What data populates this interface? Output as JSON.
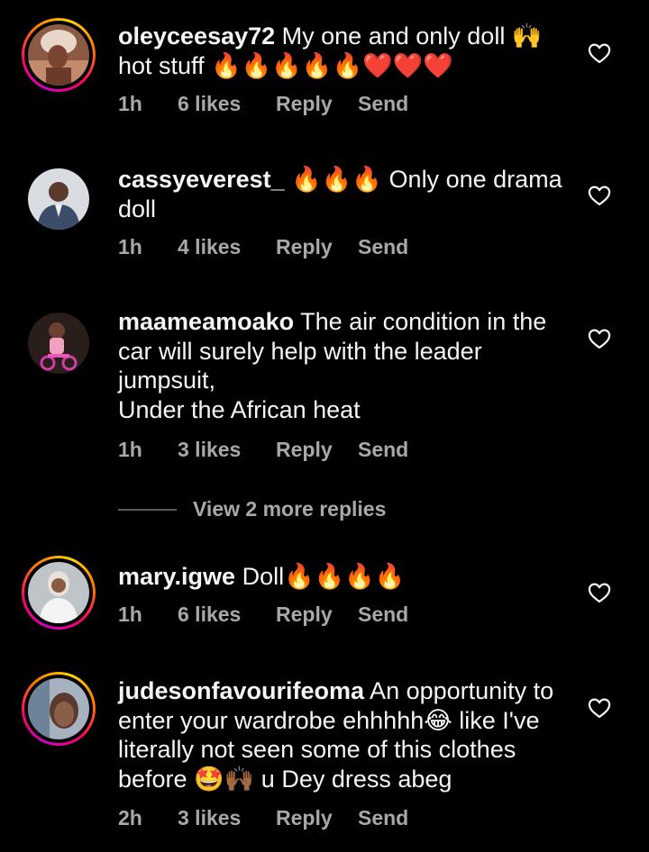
{
  "comments": [
    {
      "username": "oleyceesay72",
      "text": " My one and only doll 🙌 hot stuff 🔥🔥🔥🔥🔥❤️❤️❤️",
      "time": "1h",
      "likes": "6 likes",
      "reply": "Reply",
      "send": "Send",
      "avatar_icon": "profile-photo-woman-headwrap",
      "story_ring": true
    },
    {
      "username": "cassyeverest_",
      "text": " 🔥🔥🔥 Only one drama doll",
      "time": "1h",
      "likes": "4 likes",
      "reply": "Reply",
      "send": "Send",
      "avatar_icon": "profile-photo-man-suit",
      "story_ring": false
    },
    {
      "username": "maameamoako",
      "text": " The air condition in the car will surely help with the leader jumpsuit,\nUnder the African heat",
      "time": "1h",
      "likes": "3 likes",
      "reply": "Reply",
      "send": "Send",
      "avatar_icon": "profile-photo-child-bike",
      "story_ring": false
    },
    {
      "username": "mary.igwe",
      "text": " Doll🔥🔥🔥🔥",
      "time": "1h",
      "likes": "6 likes",
      "reply": "Reply",
      "send": "Send",
      "avatar_icon": "profile-photo-woman-white",
      "story_ring": true
    },
    {
      "username": "judesonfavourifeoma",
      "text": " An opportunity to enter your wardrobe ehhhhh😂 like I've literally not seen some of this clothes before 🤩🙌🏾 u Dey dress abeg",
      "time": "2h",
      "likes": "3 likes",
      "reply": "Reply",
      "send": "Send",
      "avatar_icon": "profile-photo-woman-selfie",
      "story_ring": true
    }
  ],
  "view_more_replies": "View 2 more replies",
  "like_icon": "heart-outline-icon",
  "colors": {
    "background": "#000000",
    "primary_text": "#f5f5f5",
    "secondary_text": "#a8a8a8"
  }
}
